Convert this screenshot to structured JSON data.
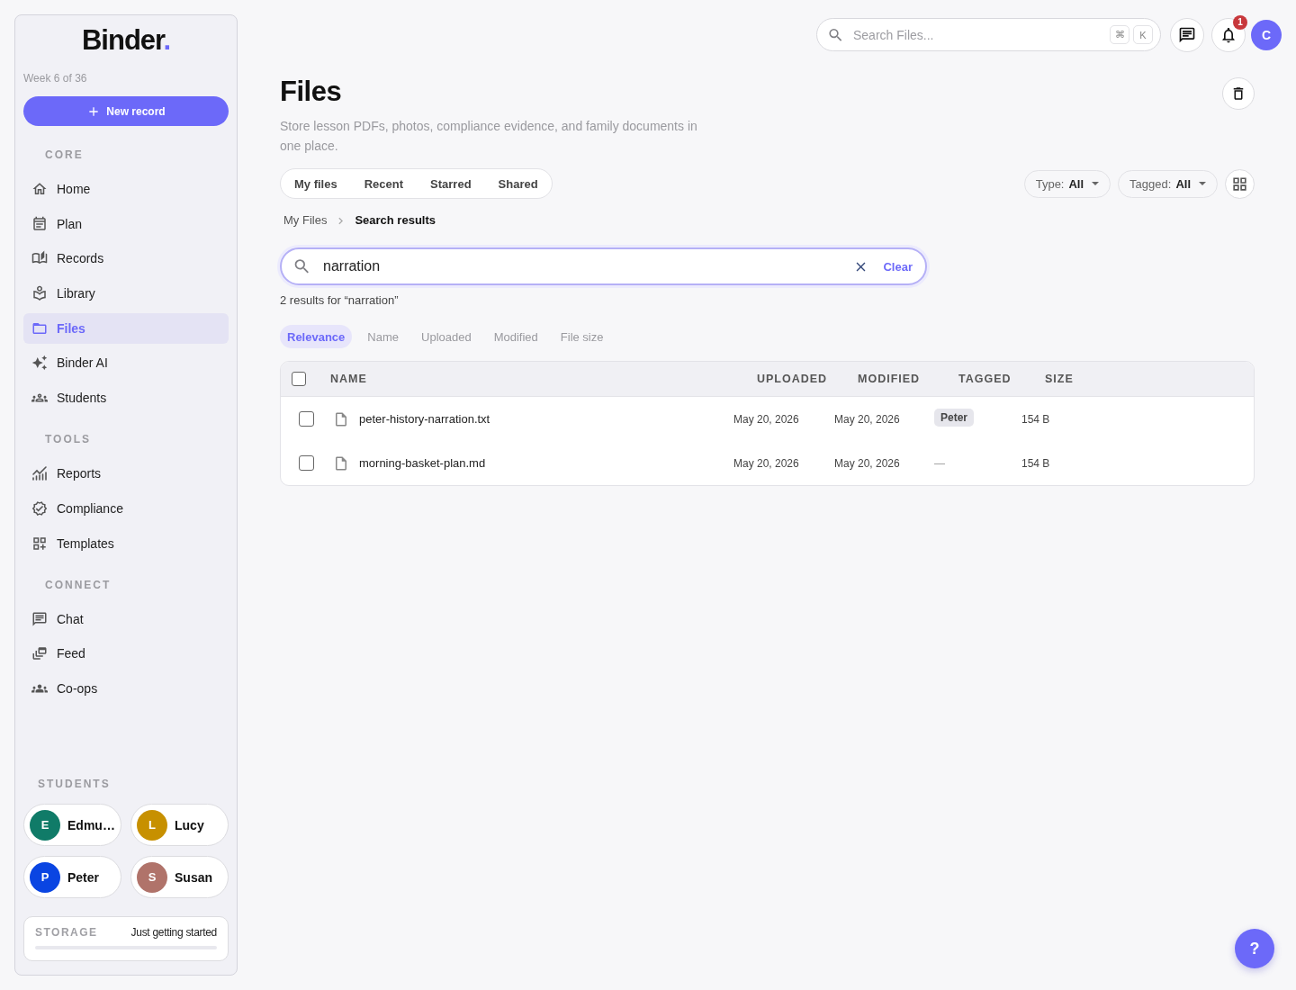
{
  "sidebar": {
    "logo": {
      "text": "Binder",
      "accent": "."
    },
    "week": "Week 6 of 36",
    "new_button": "New record",
    "sections": [
      {
        "title": "CORE",
        "items": [
          {
            "label": "Home",
            "selected": false
          },
          {
            "label": "Plan",
            "selected": false
          },
          {
            "label": "Records",
            "selected": false
          },
          {
            "label": "Library",
            "selected": false
          },
          {
            "label": "Files",
            "selected": true
          },
          {
            "label": "Binder AI",
            "selected": false
          },
          {
            "label": "Students",
            "selected": false
          }
        ]
      },
      {
        "title": "TOOLS",
        "items": [
          {
            "label": "Reports",
            "selected": false
          },
          {
            "label": "Compliance",
            "selected": false
          },
          {
            "label": "Templates",
            "selected": false
          }
        ]
      },
      {
        "title": "CONNECT",
        "items": [
          {
            "label": "Chat",
            "selected": false
          },
          {
            "label": "Feed",
            "selected": false
          },
          {
            "label": "Co-ops",
            "selected": false
          }
        ]
      }
    ],
    "students": {
      "title": "STUDENTS",
      "items": [
        {
          "initial": "E",
          "name": "Edmu…",
          "color": "#107b68"
        },
        {
          "initial": "L",
          "name": "Lucy",
          "color": "#c79000"
        },
        {
          "initial": "P",
          "name": "Peter",
          "color": "#0a45e2"
        },
        {
          "initial": "S",
          "name": "Susan",
          "color": "#b0736a"
        }
      ]
    },
    "storage": {
      "title": "STORAGE",
      "status": "Just getting started"
    }
  },
  "topbar": {
    "search": {
      "placeholder": "Search Files...",
      "keys": [
        "⌘",
        "K"
      ]
    },
    "notifications": {
      "count": "1"
    },
    "avatar": "C"
  },
  "page": {
    "title": "Files",
    "subtitle": "Store lesson PDFs, photos, compliance evidence, and family documents in one place.",
    "tabs": [
      {
        "label": "My files",
        "selected": false
      },
      {
        "label": "Recent",
        "selected": false
      },
      {
        "label": "Starred",
        "selected": false
      },
      {
        "label": "Shared",
        "selected": false
      }
    ],
    "filters": [
      {
        "label": "Type:",
        "value": "All"
      },
      {
        "label": "Tagged:",
        "value": "All"
      }
    ],
    "breadcrumb": [
      {
        "label": "My Files",
        "current": false
      },
      {
        "label": "Search results",
        "current": true
      }
    ],
    "search": {
      "value": "narration",
      "clear": "Clear"
    },
    "results": "2 results for “narration”",
    "sort": [
      {
        "label": "Relevance",
        "selected": true
      },
      {
        "label": "Name",
        "selected": false
      },
      {
        "label": "Uploaded",
        "selected": false
      },
      {
        "label": "Modified",
        "selected": false
      },
      {
        "label": "File size",
        "selected": false
      }
    ],
    "table": {
      "all_checked": false,
      "columns": [
        "NAME",
        "UPLOADED",
        "MODIFIED",
        "TAGGED",
        "SIZE"
      ],
      "rows": [
        {
          "checked": false,
          "name": "peter-history-narration.txt",
          "uploaded": "May 20, 2026",
          "modified": "May 20, 2026",
          "tagged": {
            "kind": "chip",
            "label": "Peter"
          },
          "size": "154 B"
        },
        {
          "checked": false,
          "name": "morning-basket-plan.md",
          "uploaded": "May 20, 2026",
          "modified": "May 20, 2026",
          "tagged": {
            "kind": "none",
            "label": "—"
          },
          "size": "154 B"
        }
      ]
    }
  },
  "help": "?"
}
